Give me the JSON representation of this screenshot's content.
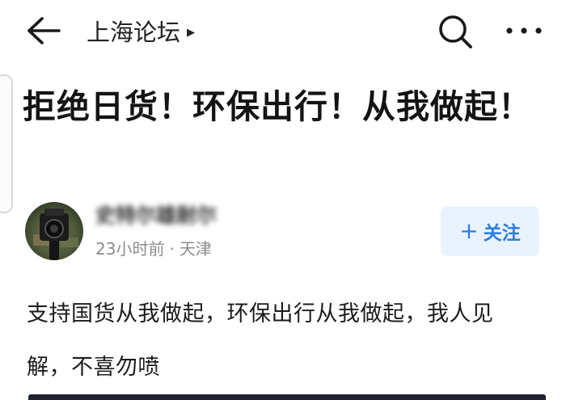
{
  "header": {
    "back_icon": "arrow-left-icon",
    "forum_name": "上海论坛",
    "forum_arrow_icon": "triangle-right-icon",
    "search_icon": "search-icon",
    "more_icon": "more-dots-icon"
  },
  "post": {
    "title": "拒绝日货！环保出行！从我做起！",
    "author": {
      "name": "史特尔雄耐尔",
      "avatar_icon": "avatar-camera-image",
      "time": "23小时前",
      "separator": "·",
      "location": "天津"
    },
    "follow_button": {
      "plus": "+",
      "label": "关注"
    },
    "body": "支持国货从我做起，环保出行从我做起，我人见解，不喜勿喷"
  },
  "colors": {
    "accent": "#2b7de0",
    "follow_bg": "#eaf3fd",
    "meta_text": "#8c8c8c"
  }
}
